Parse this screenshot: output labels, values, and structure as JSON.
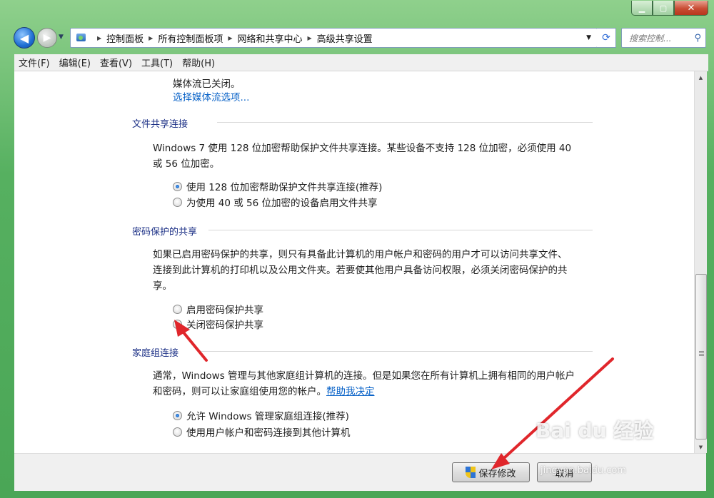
{
  "window": {
    "controls": {
      "minimize": "▁",
      "maximize": "▢",
      "close": "✕"
    }
  },
  "navbar": {
    "breadcrumb": [
      "控制面板",
      "所有控制面板项",
      "网络和共享中心",
      "高级共享设置"
    ],
    "search_placeholder": "搜索控制..."
  },
  "menu": [
    "文件(F)",
    "编辑(E)",
    "查看(V)",
    "工具(T)",
    "帮助(H)"
  ],
  "content": {
    "media_status": "媒体流已关闭。",
    "media_link": "选择媒体流选项...",
    "file_sharing": {
      "title": "文件共享连接",
      "desc_line1": "Windows 7 使用 128 位加密帮助保护文件共享连接。某些设备不支持 128 位加密，必须使用 40",
      "desc_line2": "或 56 位加密。",
      "options": [
        {
          "label": "使用 128 位加密帮助保护文件共享连接(推荐)",
          "selected": true
        },
        {
          "label": "为使用 40 或 56 位加密的设备启用文件共享",
          "selected": false
        }
      ]
    },
    "password_sharing": {
      "title": "密码保护的共享",
      "desc_line1": "如果已启用密码保护的共享，则只有具备此计算机的用户帐户和密码的用户才可以访问共享文件、",
      "desc_line2": "连接到此计算机的打印机以及公用文件夹。若要使其他用户具备访问权限，必须关闭密码保护的共",
      "desc_line3": "享。",
      "options": [
        {
          "label": "启用密码保护共享",
          "selected": false
        },
        {
          "label": "关闭密码保护共享",
          "selected": true
        }
      ]
    },
    "homegroup": {
      "title": "家庭组连接",
      "desc_line1": "通常，Windows 管理与其他家庭组计算机的连接。但是如果您在所有计算机上拥有相同的用户帐户",
      "desc_line2": "和密码，则可以让家庭组使用您的帐户。",
      "help_link": "帮助我决定",
      "options": [
        {
          "label": "允许 Windows 管理家庭组连接(推荐)",
          "selected": true
        },
        {
          "label": "使用用户帐户和密码连接到其他计算机",
          "selected": false
        }
      ]
    }
  },
  "buttons": {
    "save": "保存修改",
    "cancel": "取消"
  },
  "watermark": {
    "logo": "Bai du 经验",
    "url": "jingyan.baidu.com"
  },
  "colors": {
    "accent": "#e0262b",
    "link": "#0a63c8",
    "section": "#1e3287"
  }
}
